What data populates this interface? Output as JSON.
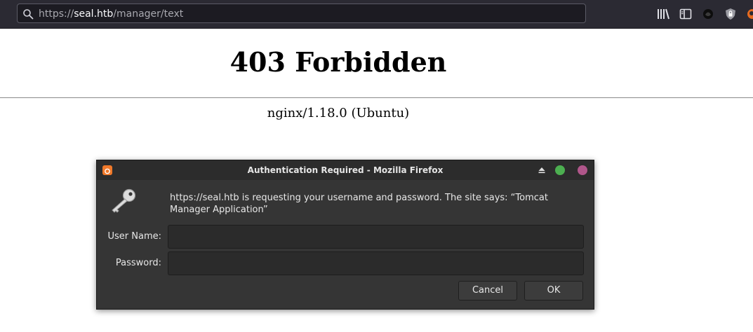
{
  "browser": {
    "url_scheme": "https://",
    "url_host": "seal.htb",
    "url_path": "/manager/text"
  },
  "page": {
    "heading": "403 Forbidden",
    "server": "nginx/1.18.0 (Ubuntu)"
  },
  "dialog": {
    "title": "Authentication Required - Mozilla Firefox",
    "message": "https://seal.htb is requesting your username and password. The site says: “Tomcat Manager Application”",
    "username_label": "User Name:",
    "password_label": "Password:",
    "username_value": "",
    "password_value": "",
    "cancel_label": "Cancel",
    "ok_label": "OK"
  },
  "icons": {
    "toolbar": [
      "library-icon",
      "sidebar-icon",
      "extension-icon",
      "shield-icon",
      "firefox-icon"
    ],
    "dialog": [
      "firefox-app-icon",
      "eject-icon",
      "maximize-icon",
      "close-icon",
      "key-icon"
    ]
  }
}
